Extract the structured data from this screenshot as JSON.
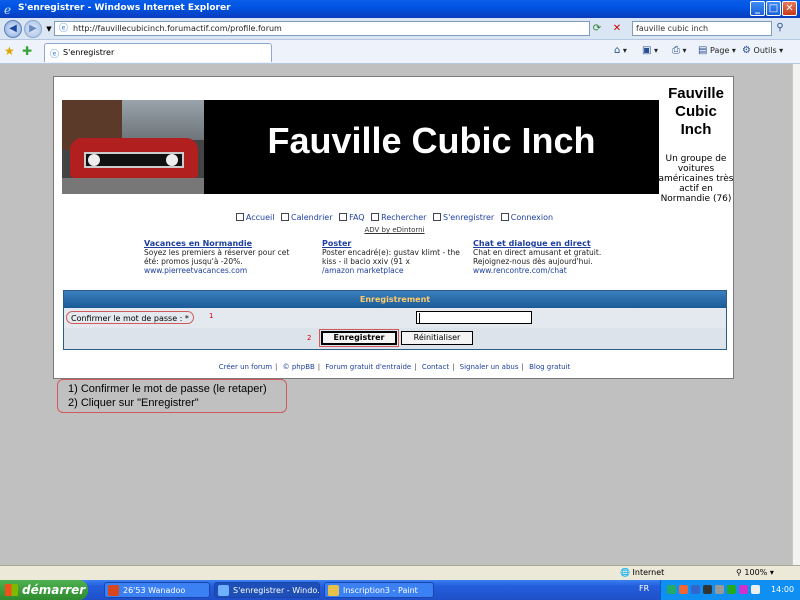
{
  "window": {
    "title": "S'enregistrer - Windows Internet Explorer",
    "min": "_",
    "max": "□",
    "close": "✕"
  },
  "address": {
    "url": "http://fauvillecubicinch.forumactif.com/profile.forum",
    "search_value": "fauville cubic inch"
  },
  "tab": {
    "label": "S'enregistrer"
  },
  "commands": {
    "page": "Page",
    "tools": "Outils"
  },
  "site": {
    "banner_title": "Fauville Cubic Inch",
    "name": "Fauville Cubic Inch",
    "description": "Un groupe de voitures américaines très actif en Normandie (76)"
  },
  "nav": {
    "items": [
      "Accueil",
      "Calendrier",
      "FAQ",
      "Rechercher",
      "S'enregistrer",
      "Connexion"
    ]
  },
  "adv": "ADV by eDintorni",
  "ads": [
    {
      "title": "Vacances en Normandie",
      "text": "Soyez les premiers à réserver pour cet été: promos jusqu'à -20%.",
      "url": "www.pierreetvacances.com"
    },
    {
      "title": "Poster",
      "text": "Poster encadré(e): gustav klimt - the kiss - il bacio xxiv (91 x",
      "url": "/amazon marketplace"
    },
    {
      "title": "Chat et dialogue en direct",
      "text": "Chat en direct amusant et gratuit. Rejoignez-nous dès aujourd'hui.",
      "url": "www.rencontre.com/chat"
    }
  ],
  "form": {
    "header": "Enregistrement",
    "confirm_label": "Confirmer le mot de passe : *",
    "step1": "1",
    "step2": "2",
    "submit": "Enregistrer",
    "reset": "Réinitialiser"
  },
  "footer": {
    "links": [
      "Créer un forum",
      "© phpBB",
      "Forum gratuit d'entraide",
      "Contact",
      "Signaler un abus",
      "Blog gratuit"
    ]
  },
  "note": {
    "line1": "1) Confirmer le mot de passe (le retaper)",
    "line2": "2) Cliquer sur \"Enregistrer\""
  },
  "status": {
    "zone": "Internet",
    "zoom": "100%"
  },
  "taskbar": {
    "start": "démarrer",
    "tasks": [
      "26'53 Wanadoo",
      "S'enregistrer - Windo...",
      "Inscription3 - Paint"
    ],
    "lang": "FR",
    "clock": "14:00"
  }
}
